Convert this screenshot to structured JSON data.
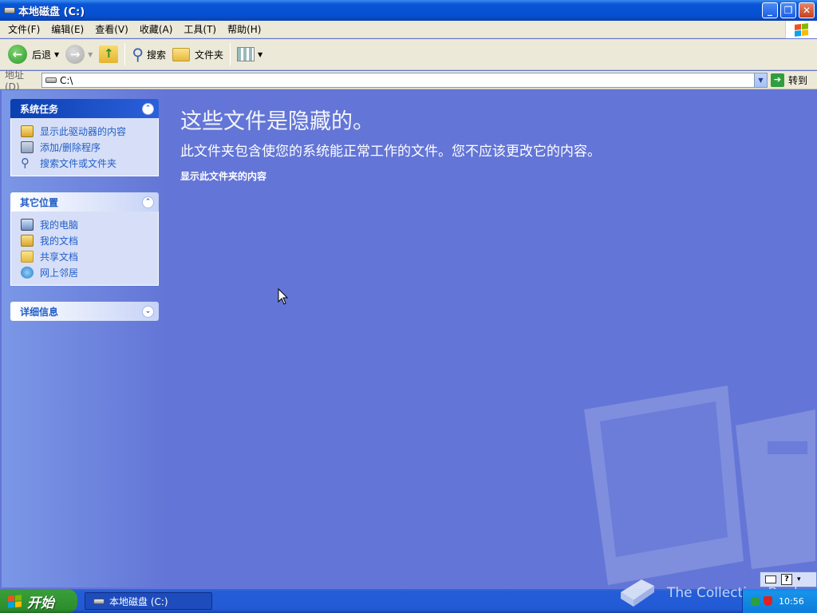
{
  "window": {
    "title": "本地磁盘  (C:)",
    "controls": {
      "minimize": "_",
      "restore": "❐",
      "close": "✕"
    }
  },
  "menubar": {
    "items": [
      "文件(F)",
      "编辑(E)",
      "查看(V)",
      "收藏(A)",
      "工具(T)",
      "帮助(H)"
    ]
  },
  "toolbar": {
    "back_label": "后退",
    "search_label": "搜索",
    "folders_label": "文件夹"
  },
  "address": {
    "label": "地址(D)",
    "value": "C:\\",
    "go_label": "转到"
  },
  "sidebar": {
    "system_tasks": {
      "title": "系统任务",
      "items": [
        "显示此驱动器的内容",
        "添加/删除程序",
        "搜索文件或文件夹"
      ]
    },
    "other_places": {
      "title": "其它位置",
      "items": [
        "我的电脑",
        "我的文档",
        "共享文档",
        "网上邻居"
      ]
    },
    "details": {
      "title": "详细信息"
    }
  },
  "content": {
    "heading": "这些文件是隐藏的。",
    "description": "此文件夹包含使您的系统能正常工作的文件。您不应该更改它的内容。",
    "show_link": "显示此文件夹的内容"
  },
  "taskbar": {
    "start_label": "开始",
    "task_label": "本地磁盘  (C:)",
    "clock": "10:56",
    "watermark": "The Collection Book"
  },
  "colors": {
    "title_blue": "#0550d0",
    "sidebar_link": "#215dc6",
    "content_bg": "#6375d6",
    "start_green": "#2d8d2d"
  }
}
